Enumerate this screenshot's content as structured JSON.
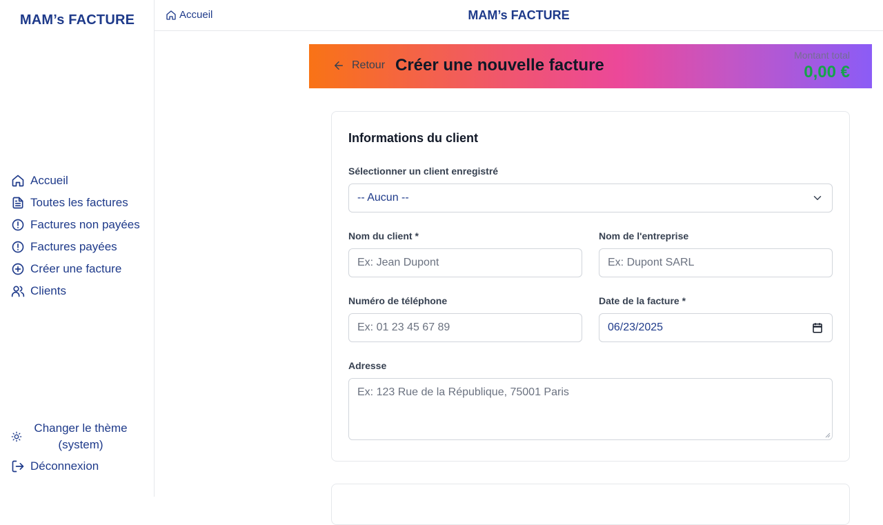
{
  "app": {
    "brand": "MAM’s FACTURE",
    "top_title": "MAM’s FACTURE"
  },
  "breadcrumb": {
    "label": "Accueil"
  },
  "sidebar": {
    "items": [
      {
        "label": "Accueil",
        "icon": "home-icon"
      },
      {
        "label": "Toutes les factures",
        "icon": "document-icon"
      },
      {
        "label": "Factures non payées",
        "icon": "alert-circle-icon"
      },
      {
        "label": "Factures payées",
        "icon": "alert-circle-icon"
      },
      {
        "label": "Créer une facture",
        "icon": "plus-circle-icon"
      },
      {
        "label": "Clients",
        "icon": "users-icon"
      }
    ],
    "theme_label_line1": "Changer le thème",
    "theme_label_line2": "(system)",
    "logout_label": "Déconnexion"
  },
  "banner": {
    "back_label": "Retour",
    "title": "Créer une nouvelle facture",
    "total_label": "Montant total",
    "total_value": "0,00 €"
  },
  "form": {
    "section_title": "Informations du client",
    "select_client": {
      "label": "Sélectionner un client enregistré",
      "value": "-- Aucun --"
    },
    "client_name": {
      "label": "Nom du client *",
      "placeholder": "Ex: Jean Dupont"
    },
    "company_name": {
      "label": "Nom de l'entreprise",
      "placeholder": "Ex: Dupont SARL"
    },
    "phone": {
      "label": "Numéro de téléphone",
      "placeholder": "Ex: 01 23 45 67 89"
    },
    "invoice_date": {
      "label": "Date de la facture *",
      "value": "06/23/2025"
    },
    "address": {
      "label": "Adresse",
      "placeholder": "Ex: 123 Rue de la République, 75001 Paris"
    }
  },
  "colors": {
    "brand": "#1e3a8a",
    "total_green": "#16a34a",
    "gradient_start": "#f97316",
    "gradient_mid": "#ec4899",
    "gradient_end": "#8b5cf6"
  }
}
